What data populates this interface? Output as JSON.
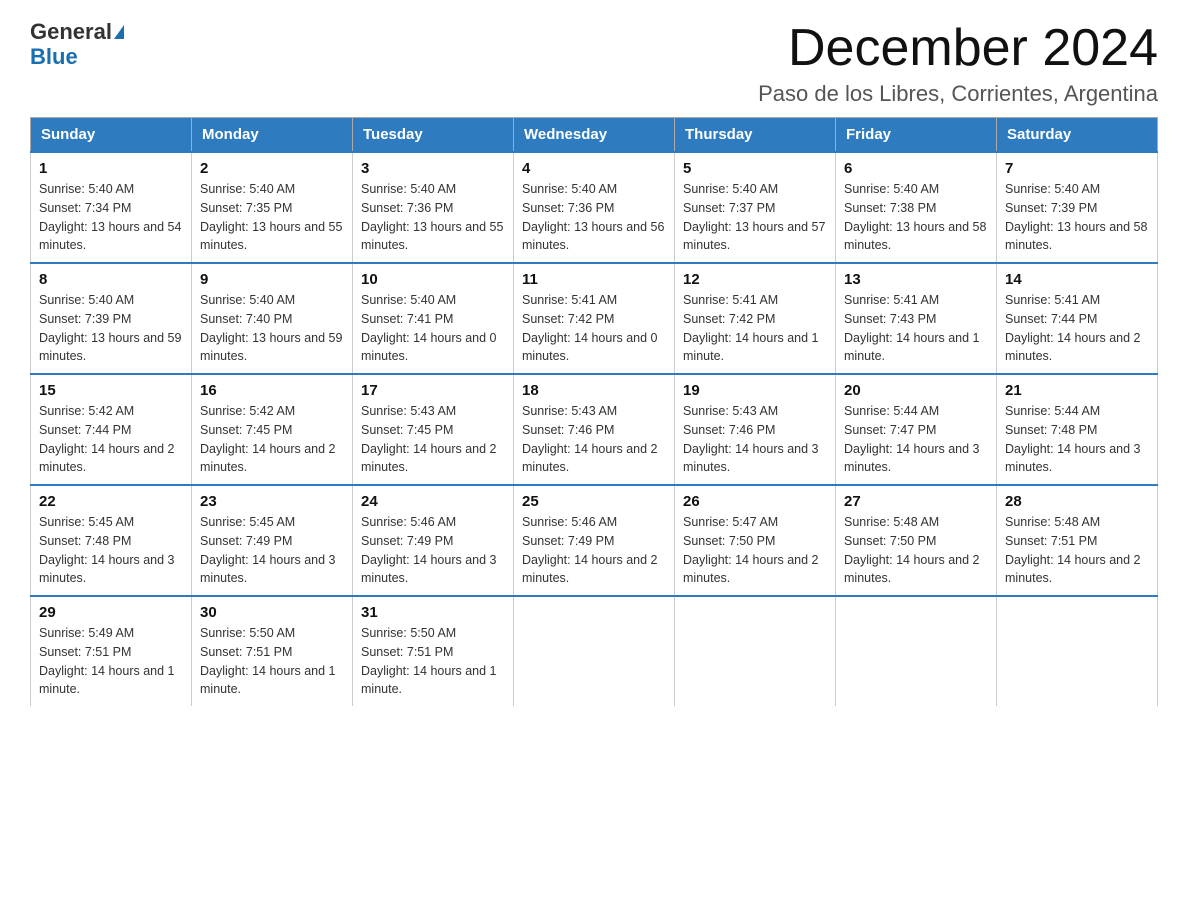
{
  "header": {
    "logo_general": "General",
    "logo_blue": "Blue",
    "month_title": "December 2024",
    "location": "Paso de los Libres, Corrientes, Argentina"
  },
  "weekdays": [
    "Sunday",
    "Monday",
    "Tuesday",
    "Wednesday",
    "Thursday",
    "Friday",
    "Saturday"
  ],
  "weeks": [
    [
      {
        "day": 1,
        "sunrise": "5:40 AM",
        "sunset": "7:34 PM",
        "daylight": "13 hours and 54 minutes."
      },
      {
        "day": 2,
        "sunrise": "5:40 AM",
        "sunset": "7:35 PM",
        "daylight": "13 hours and 55 minutes."
      },
      {
        "day": 3,
        "sunrise": "5:40 AM",
        "sunset": "7:36 PM",
        "daylight": "13 hours and 55 minutes."
      },
      {
        "day": 4,
        "sunrise": "5:40 AM",
        "sunset": "7:36 PM",
        "daylight": "13 hours and 56 minutes."
      },
      {
        "day": 5,
        "sunrise": "5:40 AM",
        "sunset": "7:37 PM",
        "daylight": "13 hours and 57 minutes."
      },
      {
        "day": 6,
        "sunrise": "5:40 AM",
        "sunset": "7:38 PM",
        "daylight": "13 hours and 58 minutes."
      },
      {
        "day": 7,
        "sunrise": "5:40 AM",
        "sunset": "7:39 PM",
        "daylight": "13 hours and 58 minutes."
      }
    ],
    [
      {
        "day": 8,
        "sunrise": "5:40 AM",
        "sunset": "7:39 PM",
        "daylight": "13 hours and 59 minutes."
      },
      {
        "day": 9,
        "sunrise": "5:40 AM",
        "sunset": "7:40 PM",
        "daylight": "13 hours and 59 minutes."
      },
      {
        "day": 10,
        "sunrise": "5:40 AM",
        "sunset": "7:41 PM",
        "daylight": "14 hours and 0 minutes."
      },
      {
        "day": 11,
        "sunrise": "5:41 AM",
        "sunset": "7:42 PM",
        "daylight": "14 hours and 0 minutes."
      },
      {
        "day": 12,
        "sunrise": "5:41 AM",
        "sunset": "7:42 PM",
        "daylight": "14 hours and 1 minute."
      },
      {
        "day": 13,
        "sunrise": "5:41 AM",
        "sunset": "7:43 PM",
        "daylight": "14 hours and 1 minute."
      },
      {
        "day": 14,
        "sunrise": "5:41 AM",
        "sunset": "7:44 PM",
        "daylight": "14 hours and 2 minutes."
      }
    ],
    [
      {
        "day": 15,
        "sunrise": "5:42 AM",
        "sunset": "7:44 PM",
        "daylight": "14 hours and 2 minutes."
      },
      {
        "day": 16,
        "sunrise": "5:42 AM",
        "sunset": "7:45 PM",
        "daylight": "14 hours and 2 minutes."
      },
      {
        "day": 17,
        "sunrise": "5:43 AM",
        "sunset": "7:45 PM",
        "daylight": "14 hours and 2 minutes."
      },
      {
        "day": 18,
        "sunrise": "5:43 AM",
        "sunset": "7:46 PM",
        "daylight": "14 hours and 2 minutes."
      },
      {
        "day": 19,
        "sunrise": "5:43 AM",
        "sunset": "7:46 PM",
        "daylight": "14 hours and 3 minutes."
      },
      {
        "day": 20,
        "sunrise": "5:44 AM",
        "sunset": "7:47 PM",
        "daylight": "14 hours and 3 minutes."
      },
      {
        "day": 21,
        "sunrise": "5:44 AM",
        "sunset": "7:48 PM",
        "daylight": "14 hours and 3 minutes."
      }
    ],
    [
      {
        "day": 22,
        "sunrise": "5:45 AM",
        "sunset": "7:48 PM",
        "daylight": "14 hours and 3 minutes."
      },
      {
        "day": 23,
        "sunrise": "5:45 AM",
        "sunset": "7:49 PM",
        "daylight": "14 hours and 3 minutes."
      },
      {
        "day": 24,
        "sunrise": "5:46 AM",
        "sunset": "7:49 PM",
        "daylight": "14 hours and 3 minutes."
      },
      {
        "day": 25,
        "sunrise": "5:46 AM",
        "sunset": "7:49 PM",
        "daylight": "14 hours and 2 minutes."
      },
      {
        "day": 26,
        "sunrise": "5:47 AM",
        "sunset": "7:50 PM",
        "daylight": "14 hours and 2 minutes."
      },
      {
        "day": 27,
        "sunrise": "5:48 AM",
        "sunset": "7:50 PM",
        "daylight": "14 hours and 2 minutes."
      },
      {
        "day": 28,
        "sunrise": "5:48 AM",
        "sunset": "7:51 PM",
        "daylight": "14 hours and 2 minutes."
      }
    ],
    [
      {
        "day": 29,
        "sunrise": "5:49 AM",
        "sunset": "7:51 PM",
        "daylight": "14 hours and 1 minute."
      },
      {
        "day": 30,
        "sunrise": "5:50 AM",
        "sunset": "7:51 PM",
        "daylight": "14 hours and 1 minute."
      },
      {
        "day": 31,
        "sunrise": "5:50 AM",
        "sunset": "7:51 PM",
        "daylight": "14 hours and 1 minute."
      },
      null,
      null,
      null,
      null
    ]
  ]
}
